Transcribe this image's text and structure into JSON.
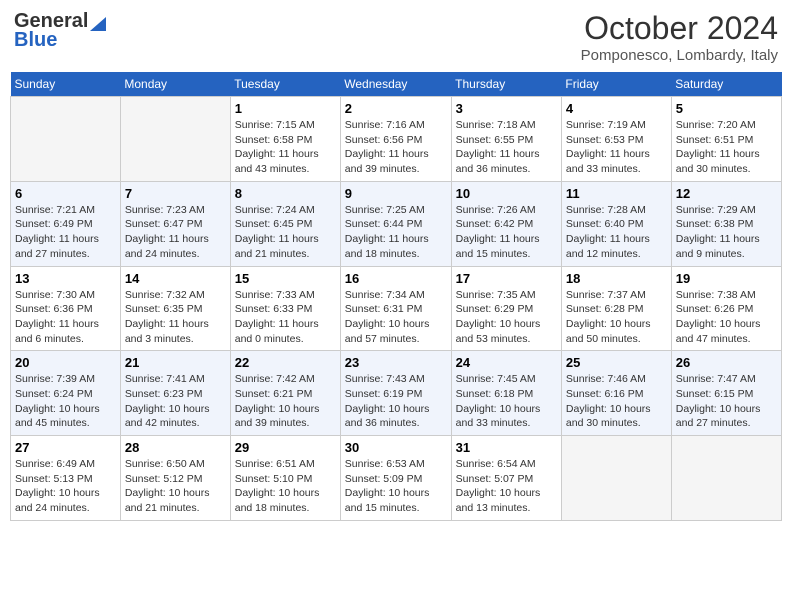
{
  "header": {
    "logo_general": "General",
    "logo_blue": "Blue",
    "month": "October 2024",
    "location": "Pomponesco, Lombardy, Italy"
  },
  "days_of_week": [
    "Sunday",
    "Monday",
    "Tuesday",
    "Wednesday",
    "Thursday",
    "Friday",
    "Saturday"
  ],
  "weeks": [
    [
      {
        "day": "",
        "info": ""
      },
      {
        "day": "",
        "info": ""
      },
      {
        "day": "1",
        "sunrise": "7:15 AM",
        "sunset": "6:58 PM",
        "daylight": "11 hours and 43 minutes."
      },
      {
        "day": "2",
        "sunrise": "7:16 AM",
        "sunset": "6:56 PM",
        "daylight": "11 hours and 39 minutes."
      },
      {
        "day": "3",
        "sunrise": "7:18 AM",
        "sunset": "6:55 PM",
        "daylight": "11 hours and 36 minutes."
      },
      {
        "day": "4",
        "sunrise": "7:19 AM",
        "sunset": "6:53 PM",
        "daylight": "11 hours and 33 minutes."
      },
      {
        "day": "5",
        "sunrise": "7:20 AM",
        "sunset": "6:51 PM",
        "daylight": "11 hours and 30 minutes."
      }
    ],
    [
      {
        "day": "6",
        "sunrise": "7:21 AM",
        "sunset": "6:49 PM",
        "daylight": "11 hours and 27 minutes."
      },
      {
        "day": "7",
        "sunrise": "7:23 AM",
        "sunset": "6:47 PM",
        "daylight": "11 hours and 24 minutes."
      },
      {
        "day": "8",
        "sunrise": "7:24 AM",
        "sunset": "6:45 PM",
        "daylight": "11 hours and 21 minutes."
      },
      {
        "day": "9",
        "sunrise": "7:25 AM",
        "sunset": "6:44 PM",
        "daylight": "11 hours and 18 minutes."
      },
      {
        "day": "10",
        "sunrise": "7:26 AM",
        "sunset": "6:42 PM",
        "daylight": "11 hours and 15 minutes."
      },
      {
        "day": "11",
        "sunrise": "7:28 AM",
        "sunset": "6:40 PM",
        "daylight": "11 hours and 12 minutes."
      },
      {
        "day": "12",
        "sunrise": "7:29 AM",
        "sunset": "6:38 PM",
        "daylight": "11 hours and 9 minutes."
      }
    ],
    [
      {
        "day": "13",
        "sunrise": "7:30 AM",
        "sunset": "6:36 PM",
        "daylight": "11 hours and 6 minutes."
      },
      {
        "day": "14",
        "sunrise": "7:32 AM",
        "sunset": "6:35 PM",
        "daylight": "11 hours and 3 minutes."
      },
      {
        "day": "15",
        "sunrise": "7:33 AM",
        "sunset": "6:33 PM",
        "daylight": "11 hours and 0 minutes."
      },
      {
        "day": "16",
        "sunrise": "7:34 AM",
        "sunset": "6:31 PM",
        "daylight": "10 hours and 57 minutes."
      },
      {
        "day": "17",
        "sunrise": "7:35 AM",
        "sunset": "6:29 PM",
        "daylight": "10 hours and 53 minutes."
      },
      {
        "day": "18",
        "sunrise": "7:37 AM",
        "sunset": "6:28 PM",
        "daylight": "10 hours and 50 minutes."
      },
      {
        "day": "19",
        "sunrise": "7:38 AM",
        "sunset": "6:26 PM",
        "daylight": "10 hours and 47 minutes."
      }
    ],
    [
      {
        "day": "20",
        "sunrise": "7:39 AM",
        "sunset": "6:24 PM",
        "daylight": "10 hours and 45 minutes."
      },
      {
        "day": "21",
        "sunrise": "7:41 AM",
        "sunset": "6:23 PM",
        "daylight": "10 hours and 42 minutes."
      },
      {
        "day": "22",
        "sunrise": "7:42 AM",
        "sunset": "6:21 PM",
        "daylight": "10 hours and 39 minutes."
      },
      {
        "day": "23",
        "sunrise": "7:43 AM",
        "sunset": "6:19 PM",
        "daylight": "10 hours and 36 minutes."
      },
      {
        "day": "24",
        "sunrise": "7:45 AM",
        "sunset": "6:18 PM",
        "daylight": "10 hours and 33 minutes."
      },
      {
        "day": "25",
        "sunrise": "7:46 AM",
        "sunset": "6:16 PM",
        "daylight": "10 hours and 30 minutes."
      },
      {
        "day": "26",
        "sunrise": "7:47 AM",
        "sunset": "6:15 PM",
        "daylight": "10 hours and 27 minutes."
      }
    ],
    [
      {
        "day": "27",
        "sunrise": "6:49 AM",
        "sunset": "5:13 PM",
        "daylight": "10 hours and 24 minutes."
      },
      {
        "day": "28",
        "sunrise": "6:50 AM",
        "sunset": "5:12 PM",
        "daylight": "10 hours and 21 minutes."
      },
      {
        "day": "29",
        "sunrise": "6:51 AM",
        "sunset": "5:10 PM",
        "daylight": "10 hours and 18 minutes."
      },
      {
        "day": "30",
        "sunrise": "6:53 AM",
        "sunset": "5:09 PM",
        "daylight": "10 hours and 15 minutes."
      },
      {
        "day": "31",
        "sunrise": "6:54 AM",
        "sunset": "5:07 PM",
        "daylight": "10 hours and 13 minutes."
      },
      {
        "day": "",
        "info": ""
      },
      {
        "day": "",
        "info": ""
      }
    ]
  ]
}
